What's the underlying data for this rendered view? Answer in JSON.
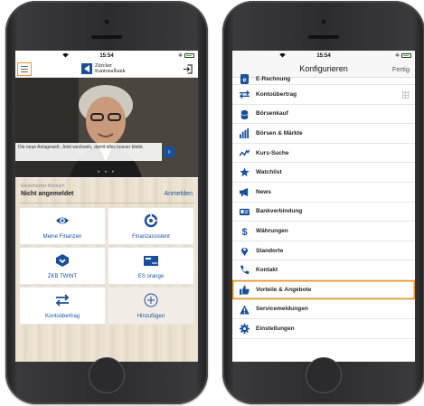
{
  "left": {
    "status": {
      "time": "15:54"
    },
    "header": {
      "logo_line1": "Zürcher",
      "logo_line2": "Kantonalbank"
    },
    "promo": {
      "text": "Die neue Anlagewelt. Jetzt wechseln, damit alles besser bleibt.",
      "arrow": "›"
    },
    "carousel_dots": "• • •",
    "login": {
      "label": "Gesicherter Bereich",
      "state": "Nicht angemeldet",
      "action": "Anmelden"
    },
    "tiles": [
      {
        "label": "Meine Finanzen",
        "icon": "eye-icon"
      },
      {
        "label": "Finanzassistent",
        "icon": "assistant-icon"
      },
      {
        "label": "ZKB TWINT",
        "icon": "twint-icon"
      },
      {
        "label": "ES orange",
        "icon": "card-icon"
      },
      {
        "label": "Kontoübertrag",
        "icon": "transfer-icon"
      },
      {
        "label": "Hinzufügen",
        "icon": "add-circle-icon"
      }
    ]
  },
  "right": {
    "status": {
      "time": "15:54"
    },
    "header": {
      "title": "Konfigurieren",
      "done": "Fertig"
    },
    "items": [
      {
        "label": "E-Rechnung",
        "icon": "ebill-icon"
      },
      {
        "label": "Kontoübertrag",
        "icon": "transfer-icon"
      },
      {
        "label": "Börsenkauf",
        "icon": "coins-icon"
      },
      {
        "label": "Börsen & Märkte",
        "icon": "bar-chart-icon"
      },
      {
        "label": "Kurs-Suche",
        "icon": "trend-icon"
      },
      {
        "label": "Watchlist",
        "icon": "star-icon"
      },
      {
        "label": "News",
        "icon": "megaphone-icon"
      },
      {
        "label": "Bankverbindung",
        "icon": "id-card-icon"
      },
      {
        "label": "Währungen",
        "icon": "dollar-icon"
      },
      {
        "label": "Standorte",
        "icon": "location-pin-icon"
      },
      {
        "label": "Kontakt",
        "icon": "phone-icon"
      },
      {
        "label": "Vorteile & Angebote",
        "icon": "thumbs-up-icon"
      },
      {
        "label": "Servicemeldungen",
        "icon": "warning-icon"
      },
      {
        "label": "Einstellungen",
        "icon": "gear-icon"
      }
    ]
  },
  "colors": {
    "brand_blue": "#1a4f9c",
    "highlight_orange": "#f0961e"
  }
}
